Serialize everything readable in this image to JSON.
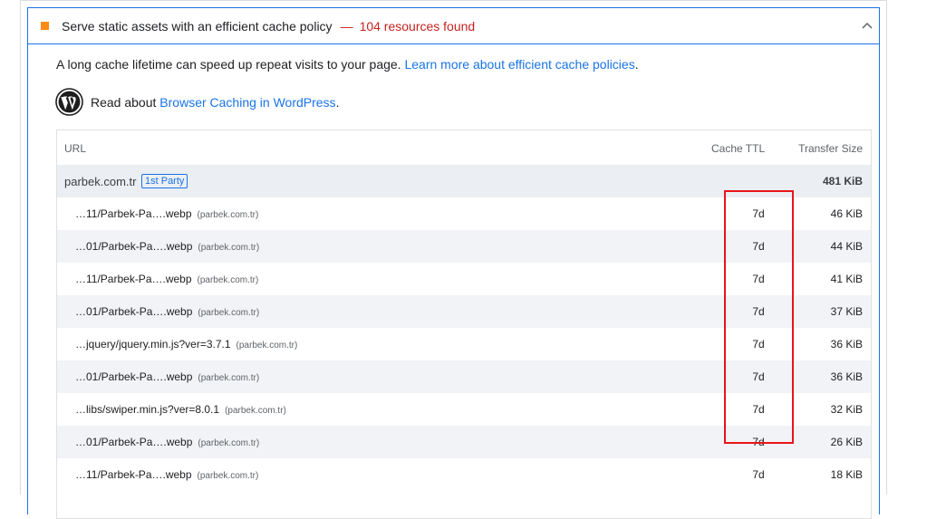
{
  "audit": {
    "title": "Serve static assets with an efficient cache policy",
    "separator": "—",
    "display_value": "104 resources found",
    "status_color": "#fa8b15",
    "display_color": "#c5221f",
    "expanded_icon": "chevron-up-icon"
  },
  "description": {
    "text": "A long cache lifetime can speed up repeat visits to your page.",
    "link": "Learn more about efficient cache policies",
    "end": "."
  },
  "wordpress_tip": {
    "icon": "wordpress-logo-icon",
    "prefix": "Read about",
    "link": "Browser Caching in WordPress",
    "end": "."
  },
  "table": {
    "headers": {
      "url": "URL",
      "ttl": "Cache TTL",
      "size": "Transfer Size"
    },
    "group": {
      "name": "parbek.com.tr",
      "badge": "1st Party",
      "size": "481 KiB"
    },
    "rows": [
      {
        "url": "…11/Parbek-Pa….webp",
        "host": "(parbek.com.tr)",
        "ttl": "7d",
        "size": "46 KiB"
      },
      {
        "url": "…01/Parbek-Pa….webp",
        "host": "(parbek.com.tr)",
        "ttl": "7d",
        "size": "44 KiB"
      },
      {
        "url": "…11/Parbek-Pa….webp",
        "host": "(parbek.com.tr)",
        "ttl": "7d",
        "size": "41 KiB"
      },
      {
        "url": "…01/Parbek-Pa….webp",
        "host": "(parbek.com.tr)",
        "ttl": "7d",
        "size": "37 KiB"
      },
      {
        "url": "…jquery/jquery.min.js?ver=3.7.1",
        "host": "(parbek.com.tr)",
        "ttl": "7d",
        "size": "36 KiB"
      },
      {
        "url": "…01/Parbek-Pa….webp",
        "host": "(parbek.com.tr)",
        "ttl": "7d",
        "size": "36 KiB"
      },
      {
        "url": "…libs/swiper.min.js?ver=8.0.1",
        "host": "(parbek.com.tr)",
        "ttl": "7d",
        "size": "32 KiB"
      },
      {
        "url": "…01/Parbek-Pa….webp",
        "host": "(parbek.com.tr)",
        "ttl": "7d",
        "size": "26 KiB"
      },
      {
        "url": "…11/Parbek-Pa….webp",
        "host": "(parbek.com.tr)",
        "ttl": "7d",
        "size": "18 KiB"
      }
    ]
  },
  "annotation": {
    "color": "#e8141b"
  }
}
